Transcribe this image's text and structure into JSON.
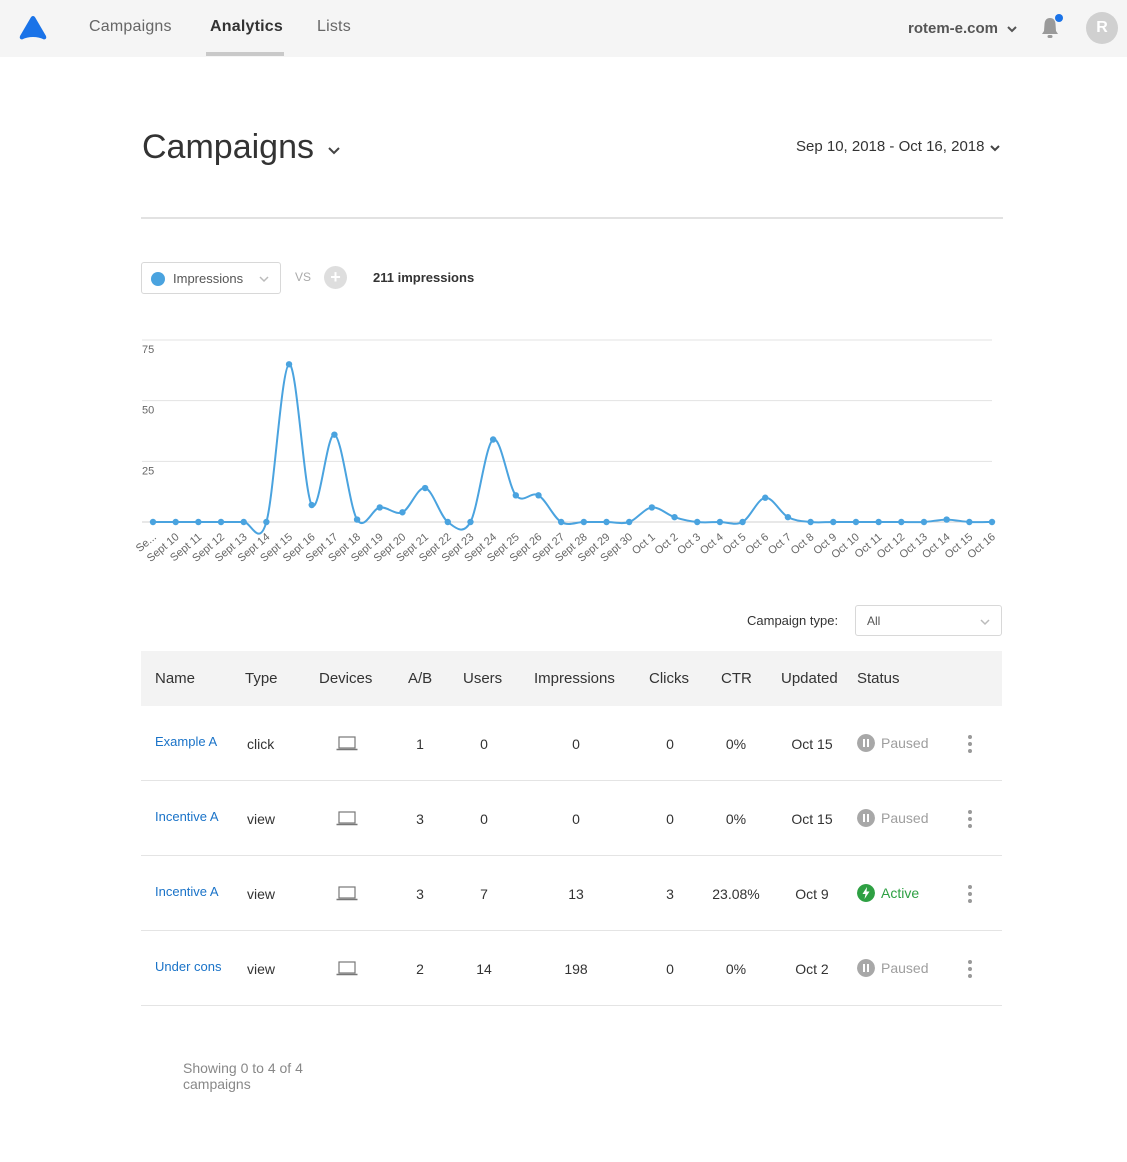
{
  "nav": {
    "items": [
      {
        "label": "Campaigns",
        "active": false
      },
      {
        "label": "Analytics",
        "active": true
      },
      {
        "label": "Lists",
        "active": false
      }
    ],
    "account": "rotem-e.com",
    "avatar_initial": "R"
  },
  "header": {
    "title": "Campaigns",
    "date_range": "Sep 10, 2018 - Oct 16, 2018"
  },
  "metric": {
    "selected": "Impressions",
    "vs_label": "VS",
    "add_label": "+",
    "total": "211 impressions"
  },
  "chart_data": {
    "type": "line",
    "title": "",
    "xlabel": "",
    "ylabel": "",
    "ylim": [
      0,
      75
    ],
    "yticks": [
      25,
      50,
      75
    ],
    "grid": true,
    "color": "#4aa3df",
    "categories": [
      "Se...",
      "Sept 10",
      "Sept 11",
      "Sept 12",
      "Sept 13",
      "Sept 14",
      "Sept 15",
      "Sept 16",
      "Sept 17",
      "Sept 18",
      "Sept 19",
      "Sept 20",
      "Sept 21",
      "Sept 22",
      "Sept 23",
      "Sept 24",
      "Sept 25",
      "Sept 26",
      "Sept 27",
      "Sept 28",
      "Sept 29",
      "Sept 30",
      "Oct 1",
      "Oct 2",
      "Oct 3",
      "Oct 4",
      "Oct 5",
      "Oct 6",
      "Oct 7",
      "Oct 8",
      "Oct 9",
      "Oct 10",
      "Oct 11",
      "Oct 12",
      "Oct 13",
      "Oct 14",
      "Oct 15",
      "Oct 16"
    ],
    "series": [
      {
        "values": [
          0,
          0,
          0,
          0,
          0,
          0,
          65,
          7,
          36,
          1,
          6,
          4,
          14,
          0,
          0,
          34,
          11,
          11,
          0,
          0,
          0,
          0,
          6,
          2,
          0,
          0,
          0,
          10,
          2,
          0,
          0,
          0,
          0,
          0,
          0,
          1,
          0,
          0
        ]
      }
    ]
  },
  "filter": {
    "label": "Campaign type:",
    "value": "All"
  },
  "table": {
    "columns": [
      "Name",
      "Type",
      "Devices",
      "A/B",
      "Users",
      "Impressions",
      "Clicks",
      "CTR",
      "Updated",
      "Status"
    ],
    "rows": [
      {
        "name": "Example A",
        "type": "click",
        "device": "desktop-icon",
        "ab": "1",
        "users": "0",
        "impressions": "0",
        "clicks": "0",
        "ctr": "0%",
        "updated": "Oct 15",
        "status": "Paused"
      },
      {
        "name": "Incentive A",
        "type": "view",
        "device": "desktop-icon",
        "ab": "3",
        "users": "0",
        "impressions": "0",
        "clicks": "0",
        "ctr": "0%",
        "updated": "Oct 15",
        "status": "Paused"
      },
      {
        "name": "Incentive A",
        "type": "view",
        "device": "desktop-icon",
        "ab": "3",
        "users": "7",
        "impressions": "13",
        "clicks": "3",
        "ctr": "23.08%",
        "updated": "Oct 9",
        "status": "Active"
      },
      {
        "name": "Under cons",
        "type": "view",
        "device": "desktop-icon",
        "ab": "2",
        "users": "14",
        "impressions": "198",
        "clicks": "0",
        "ctr": "0%",
        "updated": "Oct 2",
        "status": "Paused"
      }
    ]
  },
  "footer": {
    "summary": "Showing 0 to 4 of 4 campaigns"
  },
  "colors": {
    "accent": "#1a73e8",
    "link": "#1a73c8",
    "active": "#2ea043",
    "paused": "#9e9e9e"
  }
}
